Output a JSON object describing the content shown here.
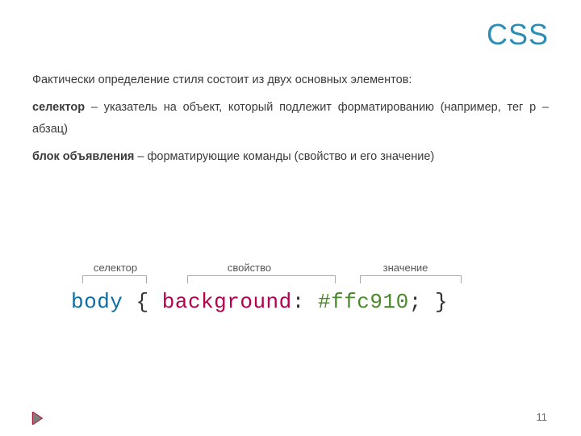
{
  "title": "CSS",
  "paragraphs": {
    "intro": "Фактически определение стиля состоит из двух основных элементов:",
    "selector_bold": "селектор",
    "selector_rest": " – указатель на объект, который подлежит форматированию (например, тег p – абзац)",
    "block_bold": "блок объявления",
    "block_rest": " – форматирующие команды (свойство и его значение)"
  },
  "diagram": {
    "label_selector": "селектор",
    "label_property": "свойство",
    "label_value": "значение",
    "code": {
      "selector": "body",
      "brace_open": " { ",
      "property": "background",
      "colon": ":",
      "space1": " ",
      "value": "#ffc910",
      "semicolon": ";",
      "brace_close": " }"
    }
  },
  "page_number": "11"
}
